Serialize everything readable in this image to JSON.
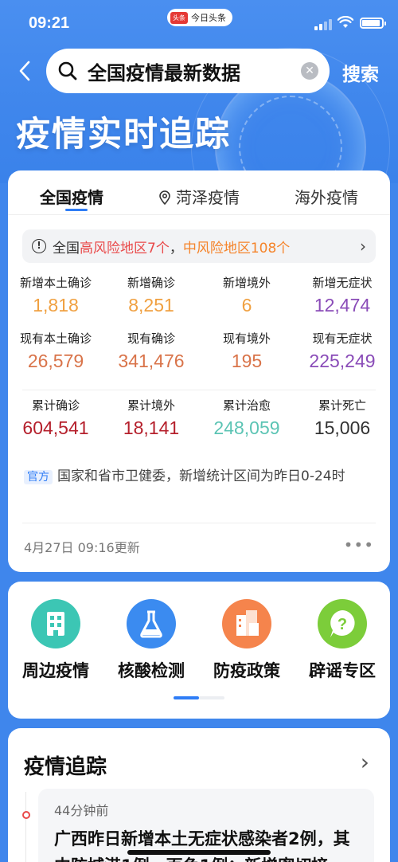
{
  "status_bar": {
    "time": "09:21",
    "app_logo": "头条",
    "app_name": "今日头条"
  },
  "search": {
    "query": "全国疫情最新数据",
    "button": "搜索"
  },
  "banner": {
    "title": "疫情实时追踪"
  },
  "tabs": [
    {
      "label": "全国疫情",
      "active": true
    },
    {
      "label": "菏泽疫情",
      "icon": "location-pin-icon"
    },
    {
      "label": "海外疫情"
    }
  ],
  "alert": {
    "prefix": "全国",
    "high_label": "高风险地区",
    "high_count": "7个",
    "sep": "，",
    "mid_label": "中风险地区",
    "mid_count": "108个"
  },
  "stats": {
    "row1": [
      {
        "label": "新增本土确诊",
        "value": "1,818",
        "color": "#f0a040"
      },
      {
        "label": "新增确诊",
        "value": "8,251",
        "color": "#f0a040"
      },
      {
        "label": "新增境外",
        "value": "6",
        "color": "#f0a040"
      },
      {
        "label": "新增无症状",
        "value": "12,474",
        "color": "#8a4cb8"
      }
    ],
    "row2": [
      {
        "label": "现有本土确诊",
        "value": "26,579",
        "color": "#d9744a"
      },
      {
        "label": "现有确诊",
        "value": "341,476",
        "color": "#d9744a"
      },
      {
        "label": "现有境外",
        "value": "195",
        "color": "#d9744a"
      },
      {
        "label": "现有无症状",
        "value": "225,249",
        "color": "#8a4cb8"
      }
    ],
    "row3": [
      {
        "label": "累计确诊",
        "value": "604,541",
        "color": "#b5202c"
      },
      {
        "label": "累计境外",
        "value": "18,141",
        "color": "#b5202c"
      },
      {
        "label": "累计治愈",
        "value": "248,059",
        "color": "#5cc4b4"
      },
      {
        "label": "累计死亡",
        "value": "15,006",
        "color": "#333333"
      }
    ]
  },
  "source": {
    "badge": "官方",
    "text": "国家和省市卫健委，新增统计区间为昨日0-24时"
  },
  "updated": "4月27日 09:16更新",
  "quick_links": [
    {
      "label": "周边疫情",
      "icon": "building-icon",
      "color": "#3cc6b4"
    },
    {
      "label": "核酸检测",
      "icon": "flask-icon",
      "color": "#3b8bf0"
    },
    {
      "label": "防疫政策",
      "icon": "city-icon",
      "color": "#f5844c"
    },
    {
      "label": "辟谣专区",
      "icon": "question-bubble-icon",
      "color": "#7ccd3a"
    }
  ],
  "tracking": {
    "title": "疫情追踪",
    "item": {
      "ago": "44分钟前",
      "headline": "广西昨日新增本土无症状感染者2例，其中防城港1例、百色1例；新增密切接"
    }
  }
}
